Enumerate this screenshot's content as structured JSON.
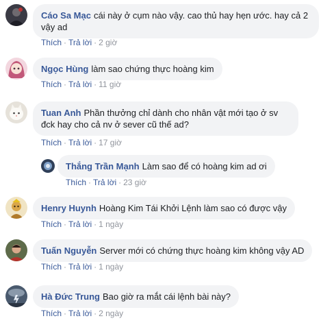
{
  "comments": [
    {
      "author": "Cáo Sa Mạc",
      "text": "cái này ở cụm nào vậy. cao thủ hay hẹn ước. hay cả 2 vậy ad",
      "like": "Thích",
      "reply": "Trả lời",
      "sep": "·",
      "time": "2 giờ",
      "avatar_icon": "avatar-dark-figure",
      "avatar_color": "#2b2b33"
    },
    {
      "author": "Ngọc Hùng",
      "text": "làm sao chứng thực hoàng kim",
      "like": "Thích",
      "reply": "Trả lời",
      "sep": "·",
      "time": "11 giờ",
      "avatar_icon": "avatar-anime-girl",
      "avatar_color": "#e8a6b8"
    },
    {
      "author": "Tuan Anh",
      "text": "Phần thưởng chỉ dành cho nhân vật mới tạo ở sv đck hay cho cả nv ở sever cũ thế ad?",
      "like": "Thích",
      "reply": "Trả lời",
      "sep": "·",
      "time": "17 giờ",
      "avatar_icon": "avatar-white-cat",
      "avatar_color": "#d9d6cf"
    },
    {
      "author": "Thắng Trần Mạnh",
      "text": "Làm sao để có hoàng kim ad ơi",
      "like": "Thích",
      "reply": "Trả lời",
      "sep": "·",
      "time": "23 giờ",
      "avatar_icon": "avatar-blue-emblem",
      "avatar_color": "#3b4f6b"
    },
    {
      "author": "Henry Huynh",
      "text": "Hoàng Kim Tái Khởi Lệnh làm sao có được vậy",
      "like": "Thích",
      "reply": "Trả lời",
      "sep": "·",
      "time": "1 ngày",
      "avatar_icon": "avatar-monkey",
      "avatar_color": "#c9a24a"
    },
    {
      "author": "Tuấn Nguyễn",
      "text": "Server mới có chứng thực hoàng kim không vậy AD",
      "like": "Thích",
      "reply": "Trả lời",
      "sep": "·",
      "time": "1 ngày",
      "avatar_icon": "avatar-person-red",
      "avatar_color": "#8a5040"
    },
    {
      "author": "Hà Đức Trung",
      "text": "Bao giờ ra mắt cái lệnh bài này?",
      "like": "Thích",
      "reply": "Trả lời",
      "sep": "·",
      "time": "2 ngày",
      "avatar_icon": "avatar-storm",
      "avatar_color": "#5a6a7c"
    }
  ],
  "colors": {
    "author": "#385898",
    "bubble": "#f2f3f5",
    "meta": "#90949c"
  }
}
